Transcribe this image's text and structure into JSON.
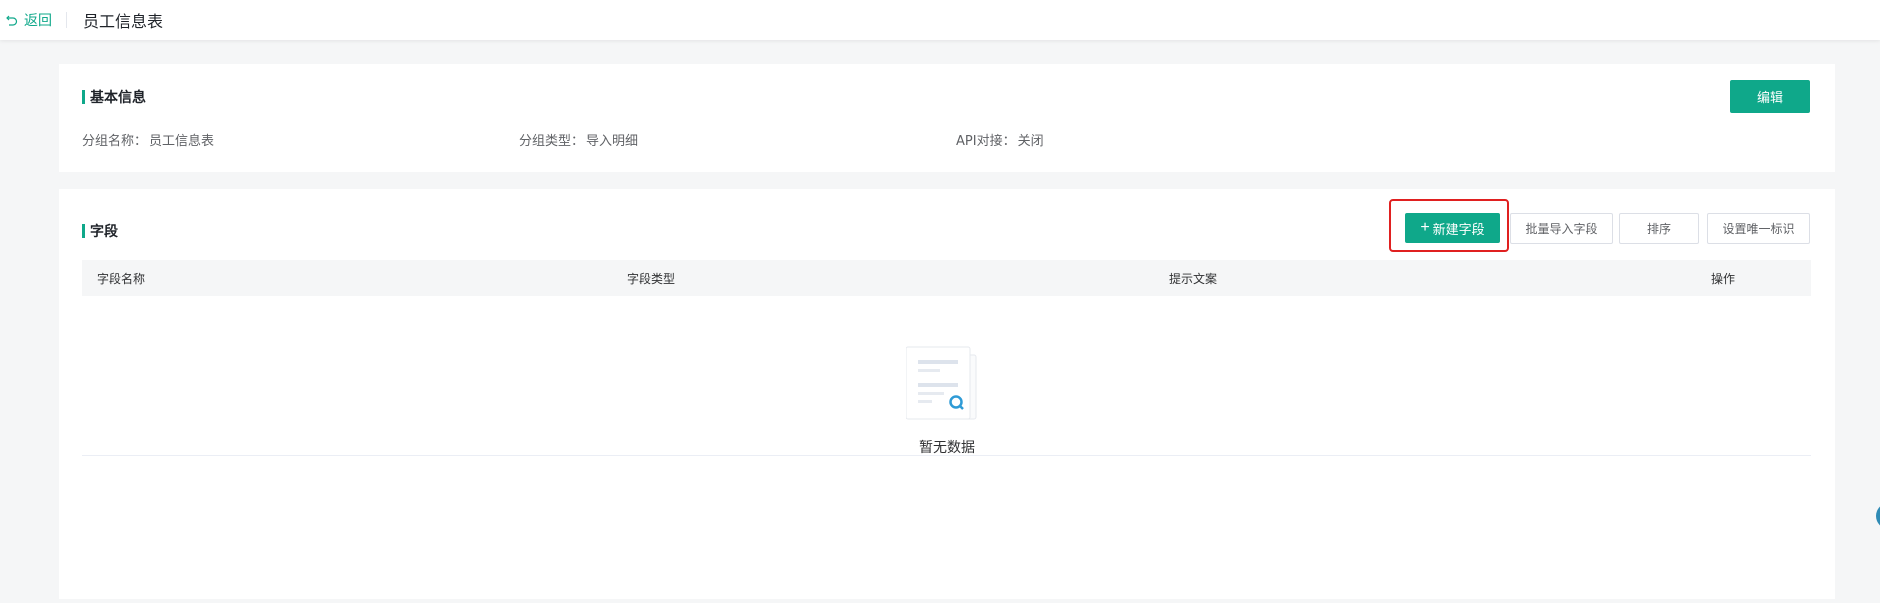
{
  "header": {
    "back_label": "返回",
    "title": "员工信息表"
  },
  "basic": {
    "section_title": "基本信息",
    "edit_label": "编辑",
    "fields": [
      {
        "label": "分组名称：",
        "value": "员工信息表"
      },
      {
        "label": "分组类型：",
        "value": "导入明细"
      },
      {
        "label": "API对接：",
        "value": "关闭"
      }
    ]
  },
  "fields": {
    "section_title": "字段",
    "buttons": {
      "new_field": "新建字段",
      "bulk_import": "批量导入字段",
      "sort": "排序",
      "unique": "设置唯一标识"
    },
    "columns": [
      "字段名称",
      "字段类型",
      "提示文案",
      "操作"
    ],
    "empty_text": "暂无数据"
  },
  "colors": {
    "accent": "#0fa88a",
    "highlight": "#e02020"
  }
}
